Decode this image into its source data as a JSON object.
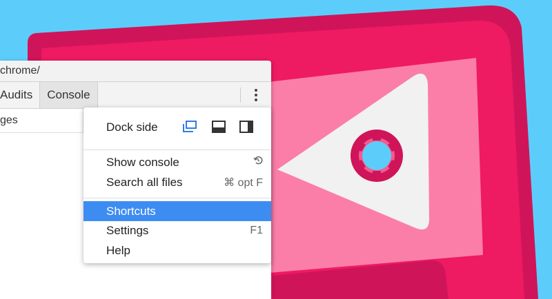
{
  "colors": {
    "background": "#5ccdfb",
    "device_dark": "#d0145a",
    "device_main": "#ee1a62",
    "screen": "#fb7ea8",
    "highlight": "#3d8cf2"
  },
  "devtools": {
    "url_text": "chrome/",
    "tabs": [
      "Audits",
      "Console"
    ],
    "sidebar_text": "ges",
    "more_icon": "kebab-icon"
  },
  "menu": {
    "dock_side_label": "Dock side",
    "dock_icons": [
      "undock-icon",
      "dock-bottom-icon",
      "dock-right-icon"
    ],
    "items": [
      {
        "label": "Show console",
        "shortcut_icon": "restore-icon"
      },
      {
        "label": "Search all files",
        "shortcut": "⌘ opt F"
      },
      {
        "label": "Shortcuts",
        "selected": true
      },
      {
        "label": "Settings",
        "shortcut": "F1"
      },
      {
        "label": "Help"
      }
    ]
  }
}
